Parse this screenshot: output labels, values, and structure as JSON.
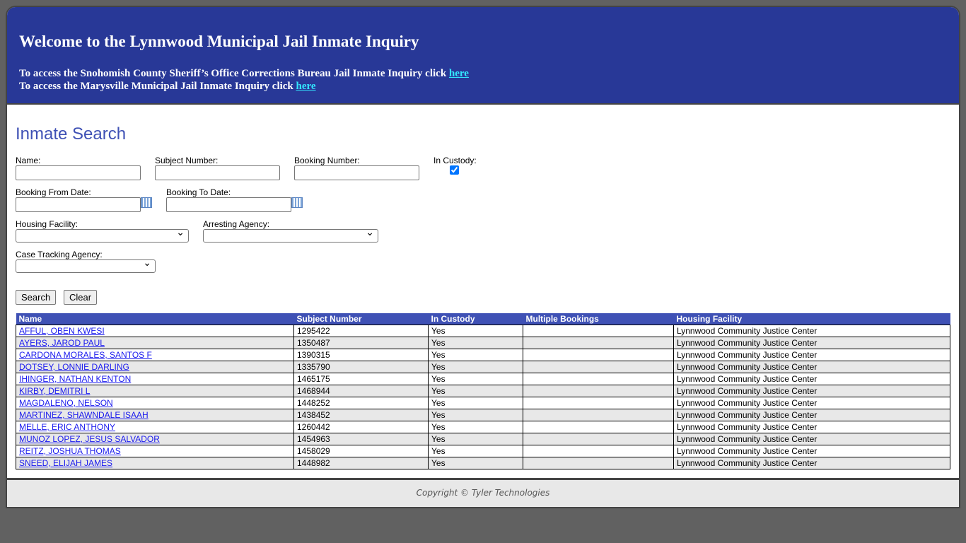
{
  "header": {
    "title": "Welcome to the Lynnwood Municipal Jail Inmate Inquiry",
    "line1": "To access the Snohomish County Sheriff’s Office Corrections Bureau Jail Inmate Inquiry click ",
    "line2": "To access the Marysville Municipal Jail Inmate Inquiry click ",
    "link": "here"
  },
  "search": {
    "title": "Inmate Search",
    "name": "Name:",
    "subject": "Subject Number:",
    "booking": "Booking Number:",
    "custody": "In Custody:",
    "from": "Booking From Date:",
    "to": "Booking To Date:",
    "housing": "Housing Facility:",
    "arresting": "Arresting Agency:",
    "case": "Case Tracking Agency:",
    "search_btn": "Search",
    "clear_btn": "Clear",
    "in_custody_checked": true
  },
  "table": {
    "headers": [
      "Name",
      "Subject Number",
      "In Custody",
      "Multiple Bookings",
      "Housing Facility"
    ],
    "rows": [
      [
        "AFFUL, OBEN KWESI",
        "1295422",
        "Yes",
        "",
        "Lynnwood Community Justice Center"
      ],
      [
        "AYERS, JAROD PAUL",
        "1350487",
        "Yes",
        "",
        "Lynnwood Community Justice Center"
      ],
      [
        "CARDONA MORALES, SANTOS F",
        "1390315",
        "Yes",
        "",
        "Lynnwood Community Justice Center"
      ],
      [
        "DOTSEY, LONNIE DARLING",
        "1335790",
        "Yes",
        "",
        "Lynnwood Community Justice Center"
      ],
      [
        "IHINGER, NATHAN KENTON",
        "1465175",
        "Yes",
        "",
        "Lynnwood Community Justice Center"
      ],
      [
        "KIRBY, DEMITRI L",
        "1468944",
        "Yes",
        "",
        "Lynnwood Community Justice Center"
      ],
      [
        "MAGDALENO, NELSON",
        "1448252",
        "Yes",
        "",
        "Lynnwood Community Justice Center"
      ],
      [
        "MARTINEZ, SHAWNDALE ISAAH",
        "1438452",
        "Yes",
        "",
        "Lynnwood Community Justice Center"
      ],
      [
        "MELLE, ERIC ANTHONY",
        "1260442",
        "Yes",
        "",
        "Lynnwood Community Justice Center"
      ],
      [
        "MUNOZ LOPEZ, JESUS SALVADOR",
        "1454963",
        "Yes",
        "",
        "Lynnwood Community Justice Center"
      ],
      [
        "REITZ, JOSHUA THOMAS",
        "1458029",
        "Yes",
        "",
        "Lynnwood Community Justice Center"
      ],
      [
        "SNEED, ELIJAH JAMES",
        "1448982",
        "Yes",
        "",
        "Lynnwood Community Justice Center"
      ]
    ]
  },
  "footer": {
    "copyright": "Copyright © Tyler Technologies"
  }
}
